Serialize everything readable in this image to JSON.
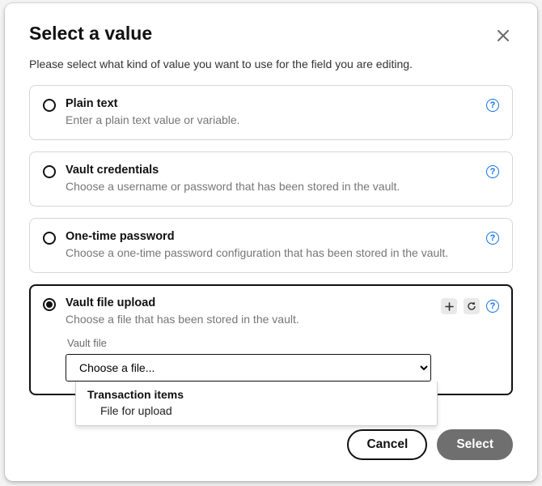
{
  "header": {
    "title": "Select a value",
    "subtitle": "Please select what kind of value you want to use for the field you are editing."
  },
  "options": [
    {
      "title": "Plain text",
      "desc": "Enter a plain text value or variable."
    },
    {
      "title": "Vault credentials",
      "desc": "Choose a username or password that has been stored in the vault."
    },
    {
      "title": "One-time password",
      "desc": "Choose a one-time password configuration that has been stored in the vault."
    },
    {
      "title": "Vault file upload",
      "desc": "Choose a file that has been stored in the vault."
    }
  ],
  "vault_file": {
    "label": "Vault file",
    "placeholder": "Choose a file...",
    "dropdown": {
      "group": "Transaction items",
      "item": "File for upload"
    }
  },
  "buttons": {
    "cancel": "Cancel",
    "select": "Select"
  }
}
